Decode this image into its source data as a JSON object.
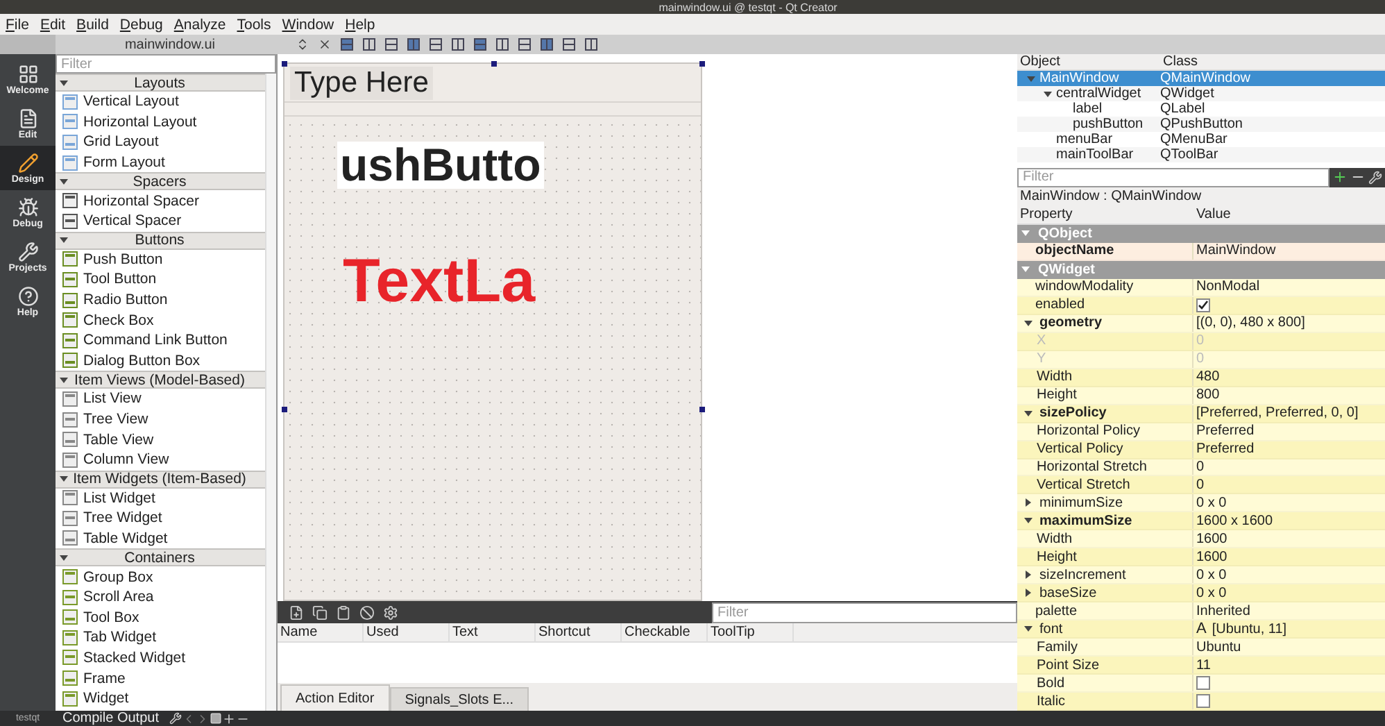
{
  "window": {
    "title": "mainwindow.ui @ testqt - Qt Creator"
  },
  "menu": [
    "File",
    "Edit",
    "Build",
    "Debug",
    "Analyze",
    "Tools",
    "Window",
    "Help"
  ],
  "editor_tab": {
    "title": "mainwindow.ui"
  },
  "modes": [
    {
      "label": "Welcome",
      "selected": false
    },
    {
      "label": "Edit",
      "selected": false
    },
    {
      "label": "Design",
      "selected": true
    },
    {
      "label": "Debug",
      "selected": false
    },
    {
      "label": "Projects",
      "selected": false
    },
    {
      "label": "Help",
      "selected": false
    }
  ],
  "widget_box": {
    "filter_placeholder": "Filter",
    "categories": [
      {
        "name": "Layouts",
        "expanded": true,
        "items": [
          "Vertical Layout",
          "Horizontal Layout",
          "Grid Layout",
          "Form Layout"
        ]
      },
      {
        "name": "Spacers",
        "expanded": true,
        "items": [
          "Horizontal Spacer",
          "Vertical Spacer"
        ]
      },
      {
        "name": "Buttons",
        "expanded": true,
        "items": [
          "Push Button",
          "Tool Button",
          "Radio Button",
          "Check Box",
          "Command Link Button",
          "Dialog Button Box"
        ]
      },
      {
        "name": "Item Views (Model-Based)",
        "expanded": true,
        "items": [
          "List View",
          "Tree View",
          "Table View",
          "Column View"
        ]
      },
      {
        "name": "Item Widgets (Item-Based)",
        "expanded": true,
        "items": [
          "List Widget",
          "Tree Widget",
          "Table Widget"
        ]
      },
      {
        "name": "Containers",
        "expanded": true,
        "items": [
          "Group Box",
          "Scroll Area",
          "Tool Box",
          "Tab Widget",
          "Stacked Widget",
          "Frame",
          "Widget"
        ]
      }
    ]
  },
  "form": {
    "menu_placeholder": "Type Here",
    "push_button": "ushButto",
    "label": "TextLa"
  },
  "action_editor": {
    "filter_placeholder": "Filter",
    "columns": [
      "Name",
      "Used",
      "Text",
      "Shortcut",
      "Checkable",
      "ToolTip"
    ],
    "tabs": [
      {
        "label": "Action Editor",
        "selected": true
      },
      {
        "label": "Signals_Slots E...",
        "selected": false
      }
    ]
  },
  "object_inspector": {
    "columns": [
      "Object",
      "Class"
    ],
    "tree": [
      {
        "object": "MainWindow",
        "class": "QMainWindow",
        "selected": true,
        "expanded": true,
        "children": [
          {
            "object": "centralWidget",
            "class": "QWidget",
            "selected": false,
            "expanded": true,
            "children": [
              {
                "object": "label",
                "class": "QLabel",
                "selected": false
              },
              {
                "object": "pushButton",
                "class": "QPushButton",
                "selected": false
              }
            ]
          },
          {
            "object": "menuBar",
            "class": "QMenuBar",
            "selected": false
          },
          {
            "object": "mainToolBar",
            "class": "QToolBar",
            "selected": false
          }
        ]
      }
    ]
  },
  "property_editor": {
    "filter_placeholder": "Filter",
    "subject": "MainWindow : QMainWindow",
    "columns": [
      "Property",
      "Value"
    ],
    "sections": [
      {
        "name": "QObject",
        "expanded": true,
        "color": "#fdeee0",
        "rows": [
          {
            "name": "objectName",
            "kind": "text",
            "value": "MainWindow",
            "modified": true
          }
        ]
      },
      {
        "name": "QWidget",
        "expanded": true,
        "color": "#fffbd6",
        "rows": [
          {
            "name": "windowModality",
            "kind": "text",
            "value": "NonModal",
            "modified": false
          },
          {
            "name": "enabled",
            "kind": "checkbox",
            "checked": true,
            "modified": false
          },
          {
            "name": "geometry",
            "kind": "text",
            "value": "[(0, 0), 480 x 800]",
            "modified": true,
            "expanded": true,
            "children": [
              {
                "name": "X",
                "kind": "text",
                "value": "0",
                "modified": false,
                "disabled": true
              },
              {
                "name": "Y",
                "kind": "text",
                "value": "0",
                "modified": false,
                "disabled": true
              },
              {
                "name": "Width",
                "kind": "text",
                "value": "480",
                "modified": false,
                "disabled": false
              },
              {
                "name": "Height",
                "kind": "text",
                "value": "800",
                "modified": false,
                "disabled": false
              }
            ]
          },
          {
            "name": "sizePolicy",
            "kind": "text",
            "value": "[Preferred, Preferred, 0, 0]",
            "modified": true,
            "expanded": true,
            "children": [
              {
                "name": "Horizontal Policy",
                "kind": "text",
                "value": "Preferred",
                "modified": false
              },
              {
                "name": "Vertical Policy",
                "kind": "text",
                "value": "Preferred",
                "modified": false
              },
              {
                "name": "Horizontal Stretch",
                "kind": "text",
                "value": "0",
                "modified": false
              },
              {
                "name": "Vertical Stretch",
                "kind": "text",
                "value": "0",
                "modified": false
              }
            ]
          },
          {
            "name": "minimumSize",
            "kind": "text",
            "value": "0 x 0",
            "modified": false,
            "expanded": false
          },
          {
            "name": "maximumSize",
            "kind": "text",
            "value": "1600 x 1600",
            "modified": true,
            "expanded": true,
            "children": [
              {
                "name": "Width",
                "kind": "text",
                "value": "1600",
                "modified": false
              },
              {
                "name": "Height",
                "kind": "text",
                "value": "1600",
                "modified": false
              }
            ]
          },
          {
            "name": "sizeIncrement",
            "kind": "text",
            "value": "0 x 0",
            "modified": false,
            "expanded": false
          },
          {
            "name": "baseSize",
            "kind": "text",
            "value": "0 x 0",
            "modified": false,
            "expanded": false
          },
          {
            "name": "palette",
            "kind": "text",
            "value": "Inherited",
            "modified": false
          },
          {
            "name": "font",
            "kind": "font",
            "icon": "A",
            "value": "[Ubuntu, 11]",
            "modified": false,
            "expanded": true,
            "children": [
              {
                "name": "Family",
                "kind": "text",
                "value": "Ubuntu",
                "modified": false
              },
              {
                "name": "Point Size",
                "kind": "text",
                "value": "11",
                "modified": false
              },
              {
                "name": "Bold",
                "kind": "checkbox",
                "checked": false,
                "modified": false
              },
              {
                "name": "Italic",
                "kind": "checkbox",
                "checked": false,
                "modified": false
              }
            ]
          }
        ]
      }
    ]
  },
  "status_bar": {
    "project": "testqt",
    "output_tab": "Compile Output"
  }
}
